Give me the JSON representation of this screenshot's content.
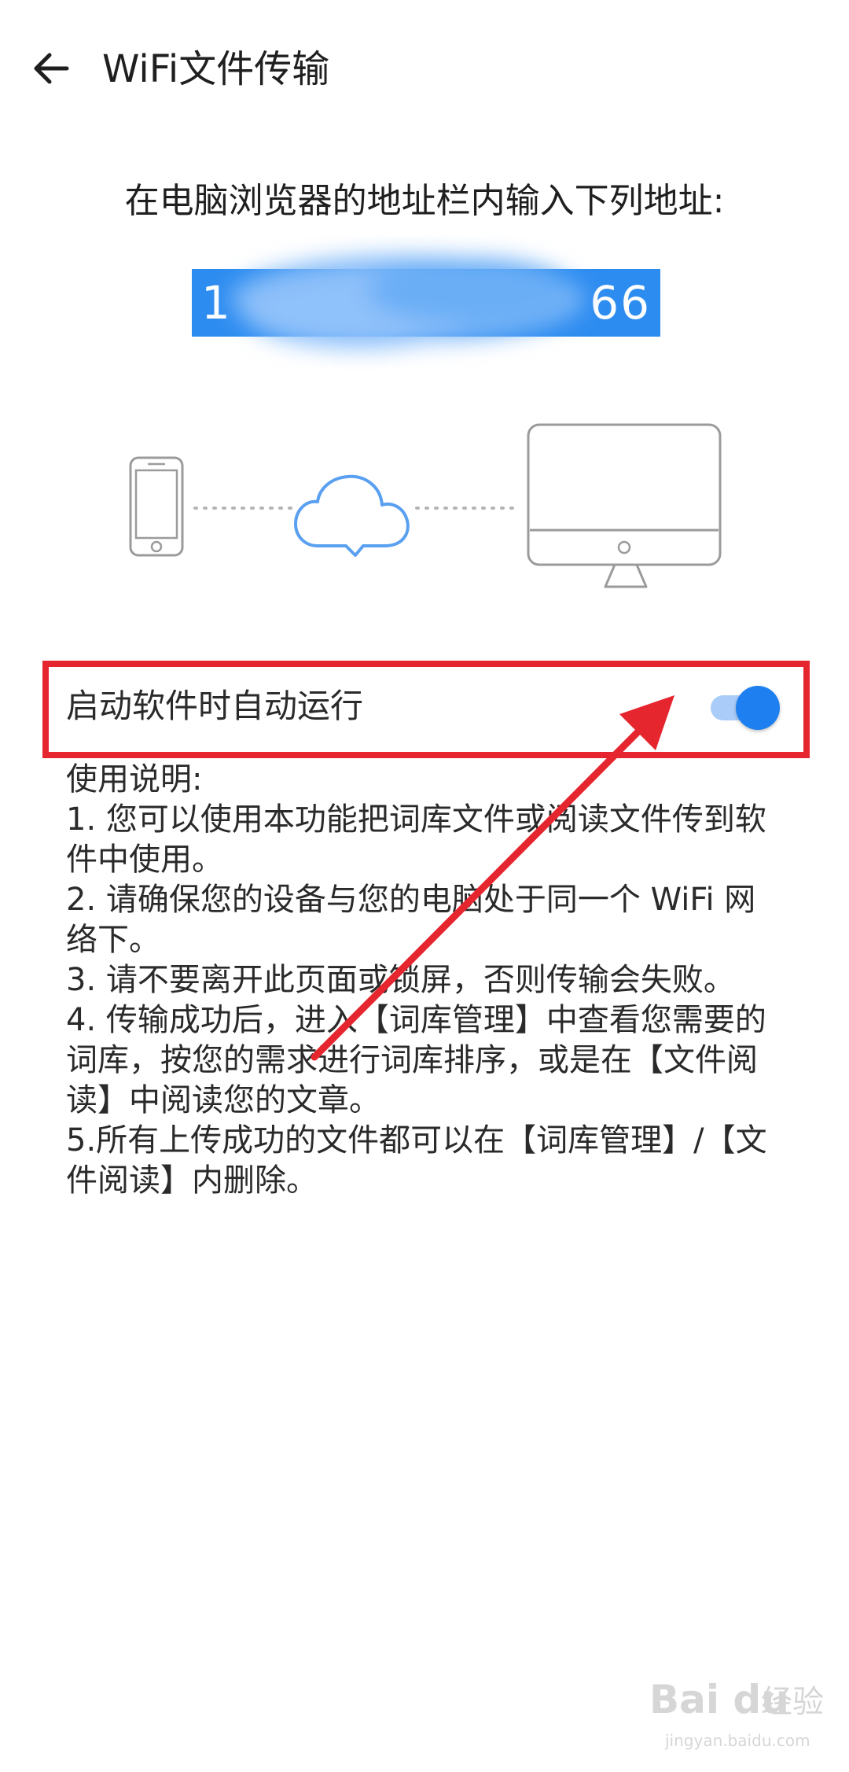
{
  "header": {
    "back_icon": "arrow-left-icon",
    "title": "WiFi文件传输"
  },
  "main": {
    "instruction": "在电脑浏览器的地址栏内输入下列地址:",
    "address": {
      "prefix": "1",
      "suffix": "66",
      "background_color": "#2d8cf0"
    },
    "diagram": {
      "icons": [
        "phone-icon",
        "cloud-icon",
        "monitor-icon"
      ]
    }
  },
  "setting": {
    "label": "启动软件时自动运行",
    "toggle_on": true,
    "accent_color": "#1e80f0"
  },
  "usage": {
    "heading": "使用说明:",
    "lines": [
      "1. 您可以使用本功能把词库文件或阅读文件传到软",
      "件中使用。",
      "2. 请确保您的设备与您的电脑处于同一个 WiFi 网",
      "络下。",
      "3. 请不要离开此页面或锁屏，否则传输会失败。",
      "4. 传输成功后，进入【词库管理】中查看您需要的",
      "词库，按您的需求进行词库排序，或是在【文件阅",
      "读】中阅读您的文章。",
      "5.所有上传成功的文件都可以在【词库管理】/【文",
      "件阅读】内删除。"
    ]
  },
  "annotation": {
    "highlight_color": "#e5262f"
  },
  "watermark": {
    "logo": "Bai du",
    "brand": "经验",
    "domain": "jingyan.baidu.com"
  }
}
